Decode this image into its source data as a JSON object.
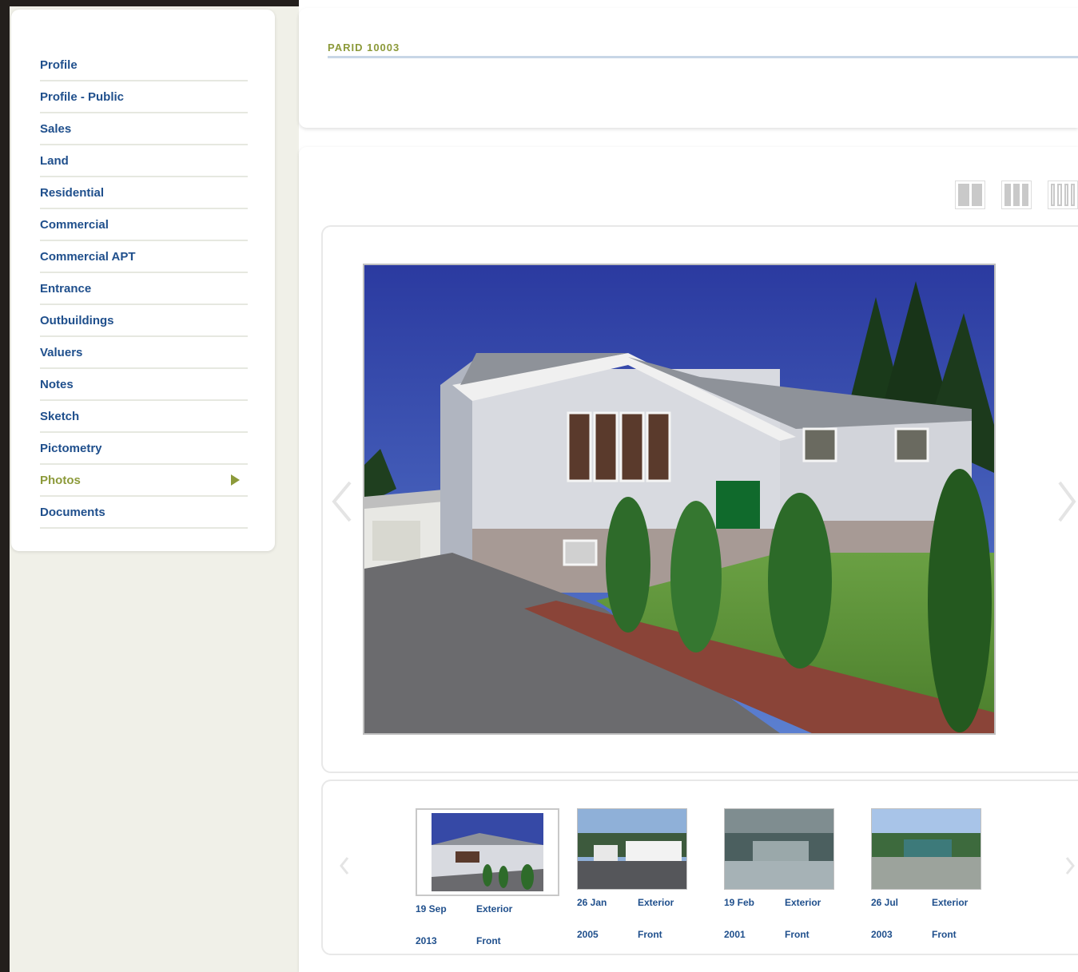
{
  "sidebar": {
    "items": [
      {
        "label": "Profile",
        "active": false
      },
      {
        "label": "Profile - Public",
        "active": false
      },
      {
        "label": "Sales",
        "active": false
      },
      {
        "label": "Land",
        "active": false
      },
      {
        "label": "Residential",
        "active": false
      },
      {
        "label": "Commercial",
        "active": false
      },
      {
        "label": "Commercial APT",
        "active": false
      },
      {
        "label": "Entrance",
        "active": false
      },
      {
        "label": "Outbuildings",
        "active": false
      },
      {
        "label": "Valuers",
        "active": false
      },
      {
        "label": "Notes",
        "active": false
      },
      {
        "label": "Sketch",
        "active": false
      },
      {
        "label": "Pictometry",
        "active": false
      },
      {
        "label": "Photos",
        "active": true
      },
      {
        "label": "Documents",
        "active": false
      }
    ],
    "active_icon": "arrow-right-icon"
  },
  "header": {
    "title": "PARID 10003",
    "subtitle": "",
    "line2": ""
  },
  "view_toggle": {
    "icons": [
      "grid-2-icon",
      "grid-3-icon",
      "grid-4-icon"
    ]
  },
  "gallery": {
    "prev_icon": "chevron-left-icon",
    "next_icon": "chevron-right-icon"
  },
  "thumbnails": [
    {
      "date_line1": "19 Sep",
      "date_line2": "2013",
      "type_line1": "Exterior",
      "type_line2": "Front",
      "selected": true
    },
    {
      "date_line1": "26 Jan",
      "date_line2": "2005",
      "type_line1": "Exterior",
      "type_line2": "Front",
      "selected": false
    },
    {
      "date_line1": "19 Feb",
      "date_line2": "2001",
      "type_line1": "Exterior",
      "type_line2": "Front",
      "selected": false
    },
    {
      "date_line1": "26 Jul",
      "date_line2": "2003",
      "type_line1": "Exterior",
      "type_line2": "Front",
      "selected": false
    }
  ],
  "colors": {
    "link": "#1f4f8c",
    "active": "#8c9a3a",
    "background": "#f0f0e8",
    "frame": "#231f1c"
  }
}
